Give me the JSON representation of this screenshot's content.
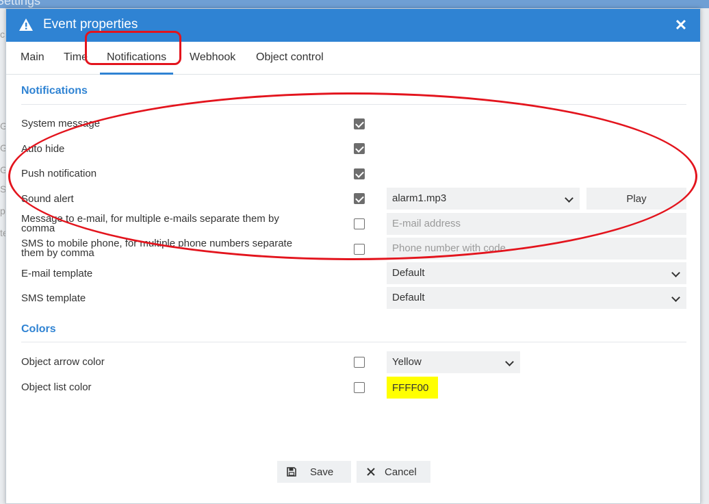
{
  "background": {
    "title": "Settings",
    "left_letters": [
      "c",
      "G",
      "G",
      "G",
      "S",
      "p",
      "te"
    ]
  },
  "dialog": {
    "title": "Event properties",
    "close_label": "✕",
    "tabs": [
      "Main",
      "Time",
      "Notifications",
      "Webhook",
      "Object control"
    ],
    "active_tab": "Notifications"
  },
  "notifications": {
    "section_title": "Notifications",
    "rows": [
      {
        "label": "System message",
        "checked": true
      },
      {
        "label": "Auto hide",
        "checked": true
      },
      {
        "label": "Push notification",
        "checked": true
      },
      {
        "label": "Sound alert",
        "checked": true,
        "sound_value": "alarm1.mp3",
        "play_label": "Play"
      },
      {
        "label": "Message to e-mail, for multiple e-mails separate them by comma",
        "checked": false,
        "placeholder": "E-mail address"
      },
      {
        "label": "SMS to mobile phone, for multiple phone numbers separate them by comma",
        "checked": false,
        "placeholder": "Phone number with code"
      }
    ],
    "email_template": {
      "label": "E-mail template",
      "value": "Default"
    },
    "sms_template": {
      "label": "SMS template",
      "value": "Default"
    }
  },
  "colors": {
    "section_title": "Colors",
    "arrow": {
      "label": "Object arrow color",
      "checked": false,
      "value": "Yellow"
    },
    "list": {
      "label": "Object list color",
      "checked": false,
      "value": "FFFF00",
      "swatch": "#ffff00"
    }
  },
  "footer": {
    "save_label": "Save",
    "cancel_label": "Cancel"
  },
  "theme": {
    "accent": "#2f83d3",
    "annotation": "#e3141d"
  }
}
